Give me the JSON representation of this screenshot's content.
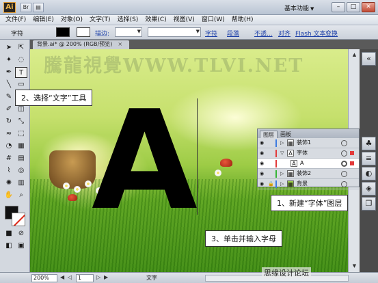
{
  "app": {
    "logo": "Ai",
    "workspace": "基本功能"
  },
  "menu": [
    "文件(F)",
    "编辑(E)",
    "对象(O)",
    "文字(T)",
    "选择(S)",
    "效果(C)",
    "视图(V)",
    "窗口(W)",
    "帮助(H)"
  ],
  "controlbar": {
    "mode_label": "字符",
    "stroke_label": "描边:",
    "char_link": "字符",
    "para_link": "段落",
    "opacity_link": "不透...",
    "align_link": "对齐",
    "flash_link": "Flash 文本",
    "transform_link": "变换",
    "fill_color": "#000000",
    "stroke_color": "#ffffff"
  },
  "document": {
    "tab_title": "背景.ai* @ 200% (RGB/预览)",
    "close": "×"
  },
  "canvas": {
    "watermark": "騰龍視覺WWW.TLVI.NET",
    "big_letter": "A"
  },
  "callouts": {
    "step2": "2、选择“文字”工具",
    "step1": "1、新建“字体”图层",
    "step3": "3、单击并输入字母"
  },
  "layers_panel": {
    "tabs": [
      "图层",
      "画板"
    ],
    "rows": [
      {
        "name": "装饰1",
        "color": "#3c7be0",
        "thumb": "▦"
      },
      {
        "name": "字体",
        "color": "#e23a3a",
        "thumb": "A"
      },
      {
        "name": "A",
        "color": "#e23a3a",
        "thumb": "A"
      },
      {
        "name": "装饰2",
        "color": "#35b535",
        "thumb": "▦"
      },
      {
        "name": "背景",
        "color": "#3c7be0",
        "thumb": "▦"
      }
    ]
  },
  "statusbar": {
    "zoom": "200%",
    "page": "1",
    "status": "文字"
  },
  "footer": "思缘设计论坛"
}
